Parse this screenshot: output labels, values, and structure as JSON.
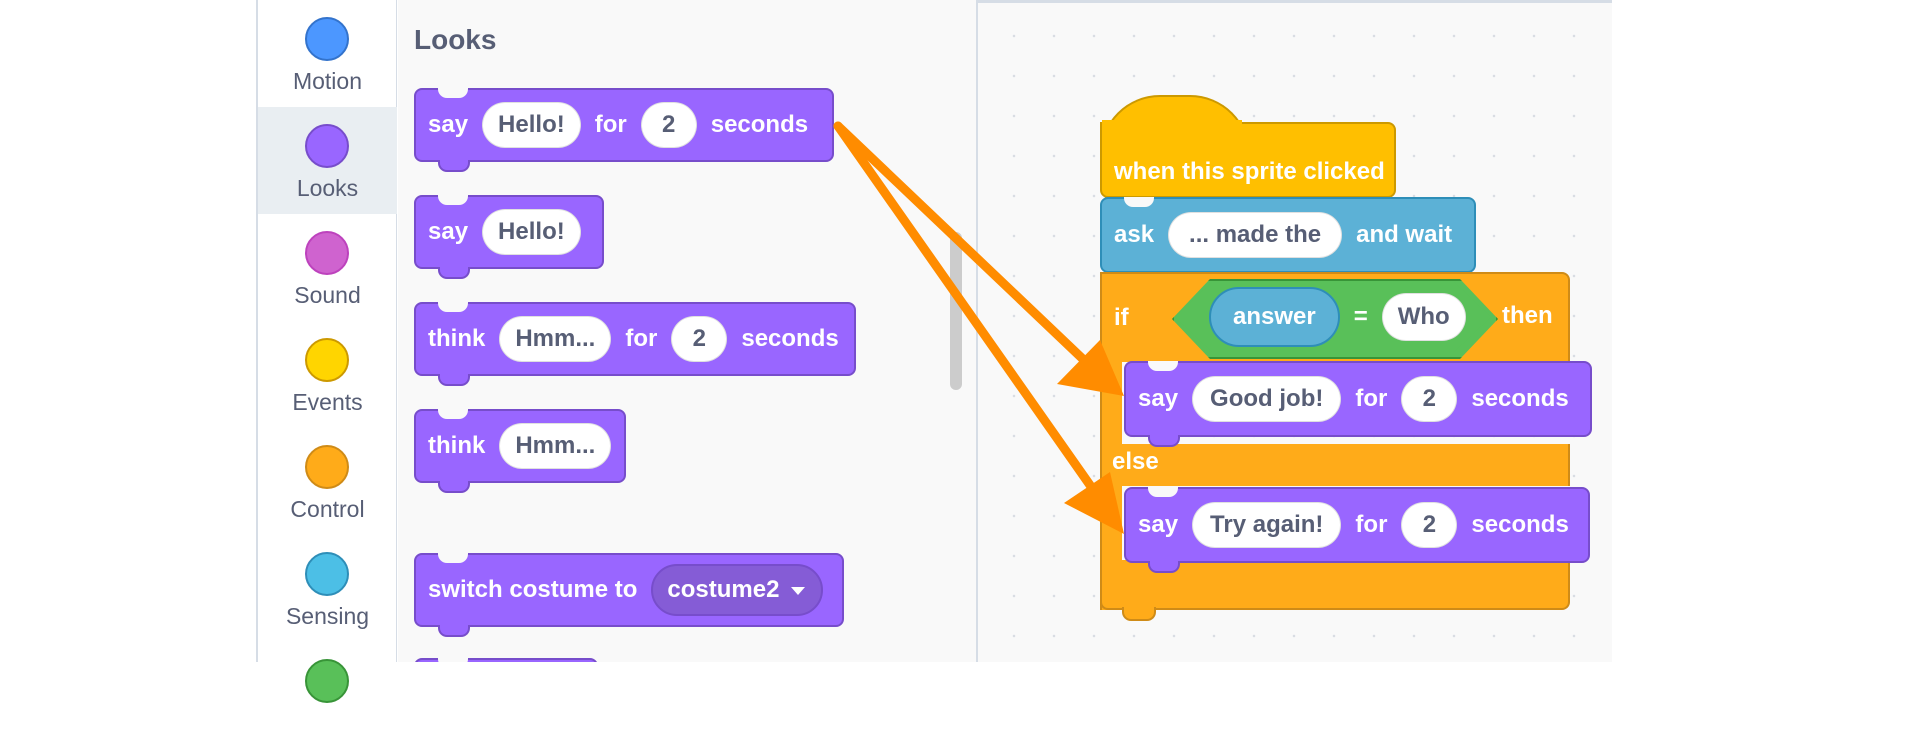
{
  "categories": [
    {
      "label": "Motion",
      "color": "#4c97ff",
      "border": "#3373cc",
      "selected": false
    },
    {
      "label": "Looks",
      "color": "#9966ff",
      "border": "#774dcb",
      "selected": true
    },
    {
      "label": "Sound",
      "color": "#cf63cf",
      "border": "#bd42bd",
      "selected": false
    },
    {
      "label": "Events",
      "color": "#ffd500",
      "border": "#cc9900",
      "selected": false
    },
    {
      "label": "Control",
      "color": "#ffab19",
      "border": "#cf8b17",
      "selected": false
    },
    {
      "label": "Sensing",
      "color": "#4cbfe6",
      "border": "#2e8eb8",
      "selected": false
    },
    {
      "label": "",
      "color": "#59c059",
      "border": "#389438",
      "selected": false
    }
  ],
  "palette": {
    "title": "Looks",
    "say_for": {
      "say": "say",
      "message": "Hello!",
      "for": "for",
      "secs": "2",
      "seconds": "seconds"
    },
    "say": {
      "say": "say",
      "message": "Hello!"
    },
    "think_for": {
      "think": "think",
      "message": "Hmm...",
      "for": "for",
      "secs": "2",
      "seconds": "seconds"
    },
    "think": {
      "think": "think",
      "message": "Hmm..."
    },
    "switch_costume": {
      "label": "switch costume to",
      "costume": "costume2"
    }
  },
  "script": {
    "hat": {
      "label": "when this sprite clicked"
    },
    "ask": {
      "ask": "ask",
      "question": "... made the",
      "and_wait": "and wait"
    },
    "if_else": {
      "if": "if",
      "then": "then",
      "else": "else",
      "condition": {
        "left": "answer",
        "op": "=",
        "right": "Who"
      }
    },
    "say_correct": {
      "say": "say",
      "message": "Good job!",
      "for": "for",
      "secs": "2",
      "seconds": "seconds"
    },
    "say_wrong": {
      "say": "say",
      "message": "Try again!",
      "for": "for",
      "secs": "2",
      "seconds": "seconds"
    }
  },
  "annotation": {
    "arrow_color": "#ff8c00"
  }
}
